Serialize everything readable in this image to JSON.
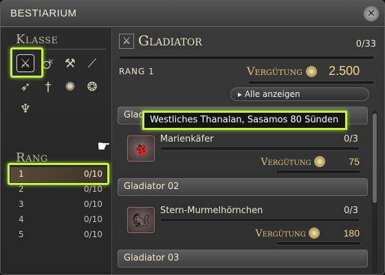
{
  "window": {
    "title": "BESTIARIUM"
  },
  "left": {
    "class_heading": "Klasse",
    "class_icons": [
      "sword-icon",
      "lance-icon",
      "axe-icon",
      "spear-icon",
      "bow-icon",
      "knife-icon",
      "claw-icon",
      "fire-icon",
      "staff-icon"
    ],
    "rank_heading": "Rang",
    "ranks": [
      {
        "n": "1",
        "v": "0/10"
      },
      {
        "n": "2",
        "v": "0/10"
      },
      {
        "n": "3",
        "v": "0/10"
      },
      {
        "n": "4",
        "v": "0/10"
      },
      {
        "n": "5",
        "v": "0/10"
      }
    ]
  },
  "right": {
    "class_name": "Gladiator",
    "class_progress": "0/33",
    "rank_label": "RANG 1",
    "reward_label": "Vergütung",
    "rank_reward": "2.500",
    "show_all": "▸ Alle anzeigen",
    "groups": [
      {
        "label": "Gladiator 01"
      },
      {
        "label": "Gladiator 02"
      },
      {
        "label": "Gladiator 03"
      }
    ],
    "monsters": [
      {
        "name": "Marienkäfer",
        "count": "0/3",
        "reward": "75"
      },
      {
        "name": "Stern-Murmelhörnchen",
        "count": "0/3",
        "reward": "180"
      }
    ]
  },
  "tooltip": {
    "text": "Westliches Thanalan, Sasamos 80 Sünden"
  },
  "colors": {
    "highlight": "#c4f24a",
    "gold": "#f5d68a"
  }
}
